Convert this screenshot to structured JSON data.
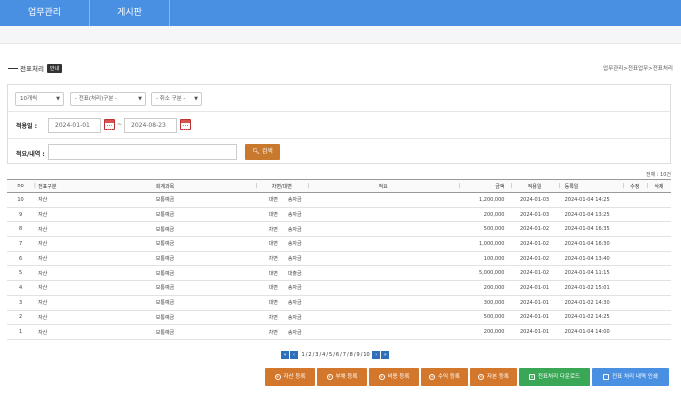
{
  "nav": {
    "tabs": [
      "업무관리",
      "게시판"
    ]
  },
  "page": {
    "title": "전표처리",
    "badge": "안내",
    "breadcrumb": "업무관리>전표업무>전표처리"
  },
  "filters": {
    "page_size": "10개씩",
    "voucher_type": "- 전표(처리)구분 -",
    "cancel_type": "- 취소 구분 -",
    "apply_date_label": "적용일 :",
    "date_from": "2024-01-01",
    "tilde": "~",
    "date_to": "2024-08-23",
    "memo_label": "적요/내역 :",
    "memo_value": "",
    "search_label": "검색"
  },
  "table": {
    "total_label": "전체 : 10건",
    "headers": [
      "no",
      "전표구분",
      "회계과목",
      "차변/대변",
      "적요",
      "금액",
      "적용일",
      "등록일",
      "수정",
      "삭제"
    ],
    "rows": [
      [
        "10",
        "자산",
        "보통예금",
        "대변",
        "송자금",
        "",
        "1,200,000",
        "2024-01-03",
        "2024-01-04 14:25",
        "",
        ""
      ],
      [
        "9",
        "자산",
        "보통예금",
        "대변",
        "송자금",
        "",
        "200,000",
        "2024-01-03",
        "2024-01-04 13:25",
        "",
        ""
      ],
      [
        "8",
        "자산",
        "보통예금",
        "차변",
        "송자금",
        "",
        "500,000",
        "2024-01-02",
        "2024-01-04 16:35",
        "",
        ""
      ],
      [
        "7",
        "자산",
        "보통예금",
        "대변",
        "송자금",
        "",
        "1,000,000",
        "2024-01-02",
        "2024-01-04 16:30",
        "",
        ""
      ],
      [
        "6",
        "자산",
        "보통예금",
        "차변",
        "송자금",
        "",
        "100,000",
        "2024-01-02",
        "2024-01-04 13:40",
        "",
        ""
      ],
      [
        "5",
        "자산",
        "보통예금",
        "대변",
        "대출금",
        "",
        "5,000,000",
        "2024-01-02",
        "2024-01-04 11:15",
        "",
        ""
      ],
      [
        "4",
        "자산",
        "보통예금",
        "대변",
        "송자금",
        "",
        "200,000",
        "2024-01-01",
        "2024-01-02 15:01",
        "",
        ""
      ],
      [
        "3",
        "자산",
        "보통예금",
        "대변",
        "송자금",
        "",
        "300,000",
        "2024-01-01",
        "2024-01-02 14:30",
        "",
        ""
      ],
      [
        "2",
        "자산",
        "보통예금",
        "차변",
        "송자금",
        "",
        "500,000",
        "2024-01-01",
        "2024-01-02 14:25",
        "",
        ""
      ],
      [
        "1",
        "자산",
        "보통예금",
        "차변",
        "송자금",
        "",
        "200,000",
        "2024-01-01",
        "2024-01-04 14:00",
        "",
        ""
      ]
    ]
  },
  "pagination": {
    "first": "«",
    "prev": "‹",
    "pages": [
      "1",
      "/",
      "2",
      "/",
      "3",
      "/",
      "4",
      "/",
      "5",
      "/",
      "6",
      "/",
      "7",
      "/",
      "8",
      "/",
      "9",
      "/",
      "10"
    ],
    "next": "›",
    "last": "»"
  },
  "actions": {
    "asset": "자산 등록",
    "liability": "부채 등록",
    "expense": "비용 등록",
    "income": "수익 등록",
    "capital": "자본 등록",
    "download": "전표처리 다운로드",
    "print": "전표 처리 내역 인쇄"
  },
  "colors": {
    "nav": "#4a90e2",
    "orange": "#d2772c",
    "green": "#3aa757",
    "pager": "#2f6fba"
  }
}
